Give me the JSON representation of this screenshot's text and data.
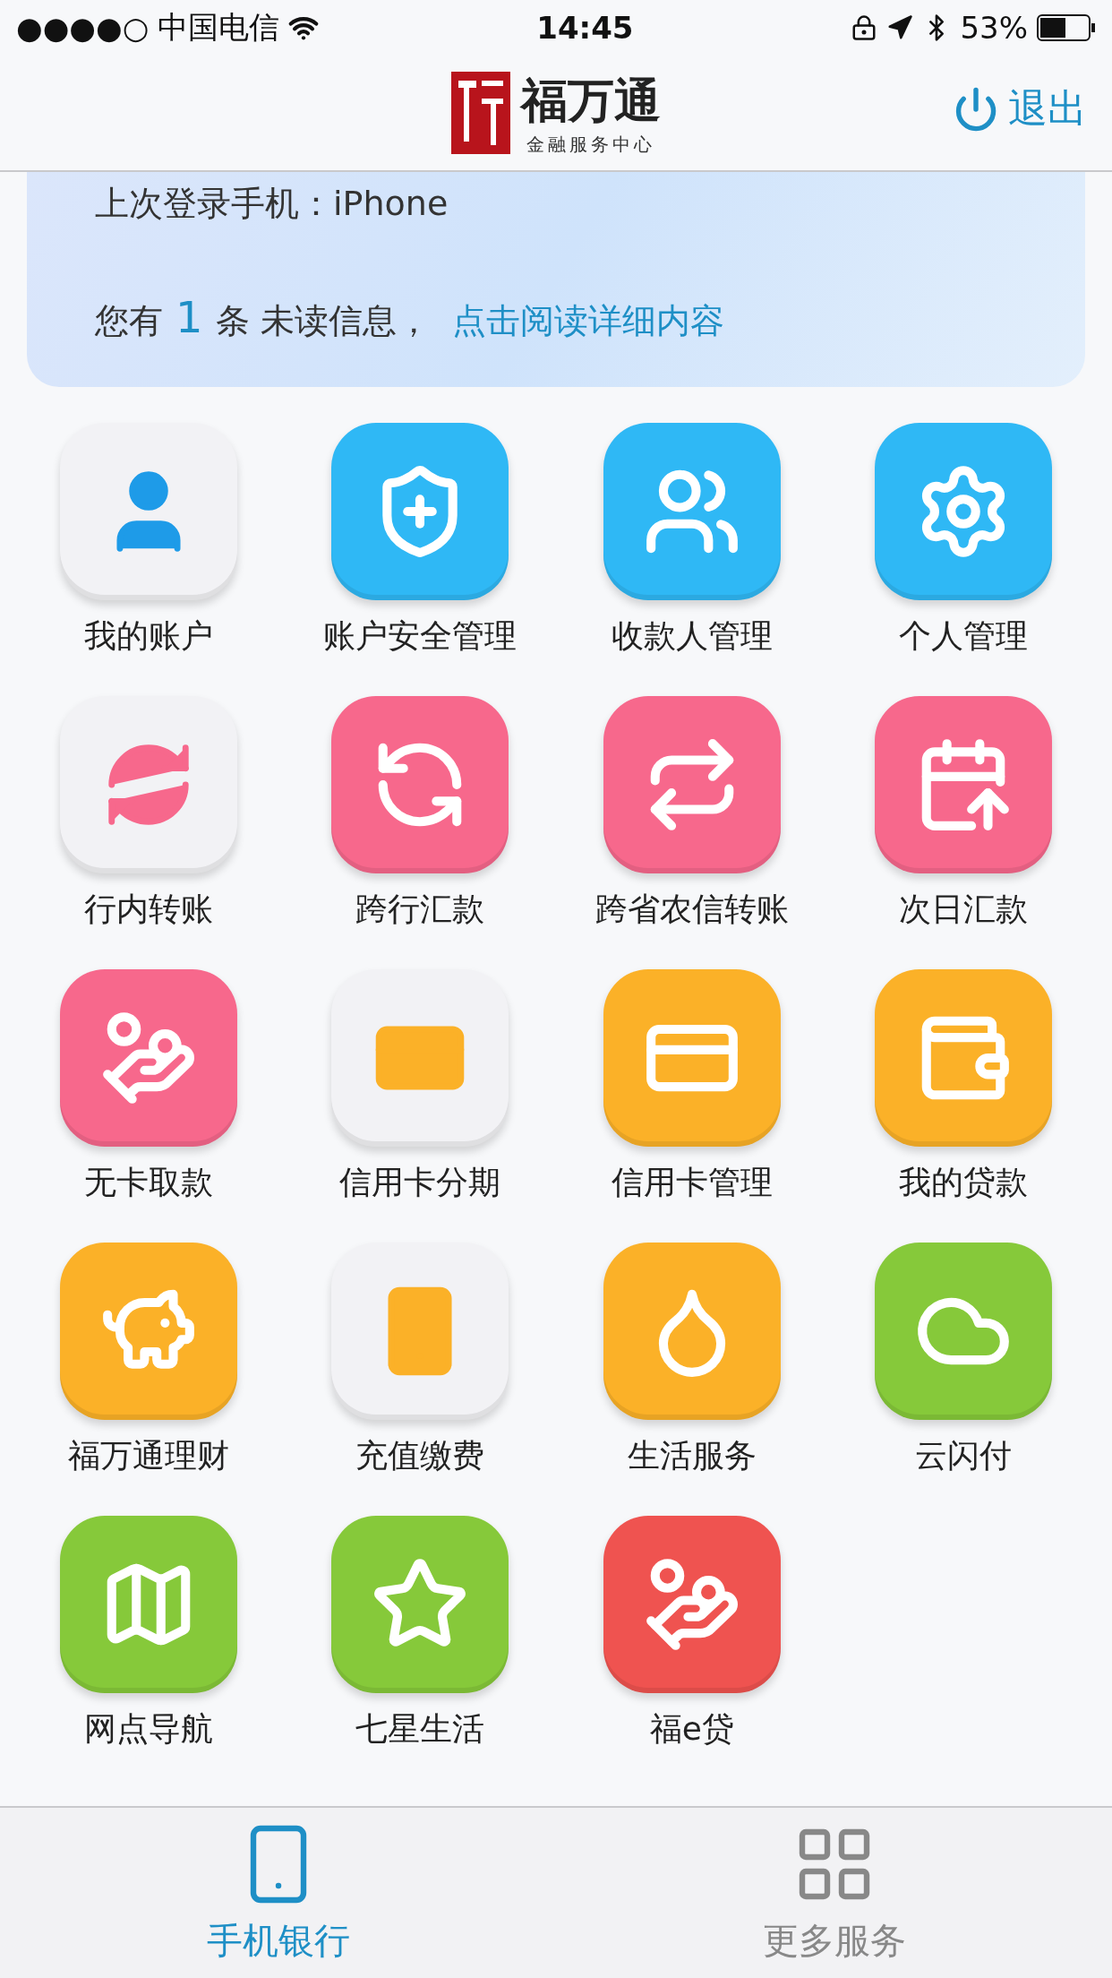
{
  "status_bar": {
    "signal": "●●●●○",
    "carrier": "中国电信",
    "time": "14:45",
    "battery": "53%"
  },
  "header": {
    "logo_title": "福万通",
    "logo_subtitle": "金融服务中心",
    "logout": "退出"
  },
  "banner": {
    "last_login": "上次登录手机：iPhone",
    "unread_prefix": "您有",
    "unread_count": "1",
    "unread_suffix": "条 未读信息，",
    "read_link": "点击阅读详细内容"
  },
  "services": [
    {
      "label": "我的账户",
      "color": "#f2f2f5"
    },
    {
      "label": "账户安全管理",
      "color": "#2fb8f5"
    },
    {
      "label": "收款人管理",
      "color": "#2fb8f5"
    },
    {
      "label": "个人管理",
      "color": "#2fb8f5"
    },
    {
      "label": "行内转账",
      "color": "#f2f2f5"
    },
    {
      "label": "跨行汇款",
      "color": "#f7688c"
    },
    {
      "label": "跨省农信转账",
      "color": "#f7688c"
    },
    {
      "label": "次日汇款",
      "color": "#f7688c"
    },
    {
      "label": "无卡取款",
      "color": "#f7688c"
    },
    {
      "label": "信用卡分期",
      "color": "#f2f2f5"
    },
    {
      "label": "信用卡管理",
      "color": "#fbb128"
    },
    {
      "label": "我的贷款",
      "color": "#fbb128"
    },
    {
      "label": "福万通理财",
      "color": "#fbb128"
    },
    {
      "label": "充值缴费",
      "color": "#f2f2f5"
    },
    {
      "label": "生活服务",
      "color": "#fbb128"
    },
    {
      "label": "云闪付",
      "color": "#86c93a"
    },
    {
      "label": "网点导航",
      "color": "#86c93a"
    },
    {
      "label": "七星生活",
      "color": "#86c93a"
    },
    {
      "label": "福e贷",
      "color": "#ef5350"
    }
  ],
  "tabs": [
    {
      "label": "手机银行",
      "selected": true
    },
    {
      "label": "更多服务",
      "selected": false
    }
  ]
}
